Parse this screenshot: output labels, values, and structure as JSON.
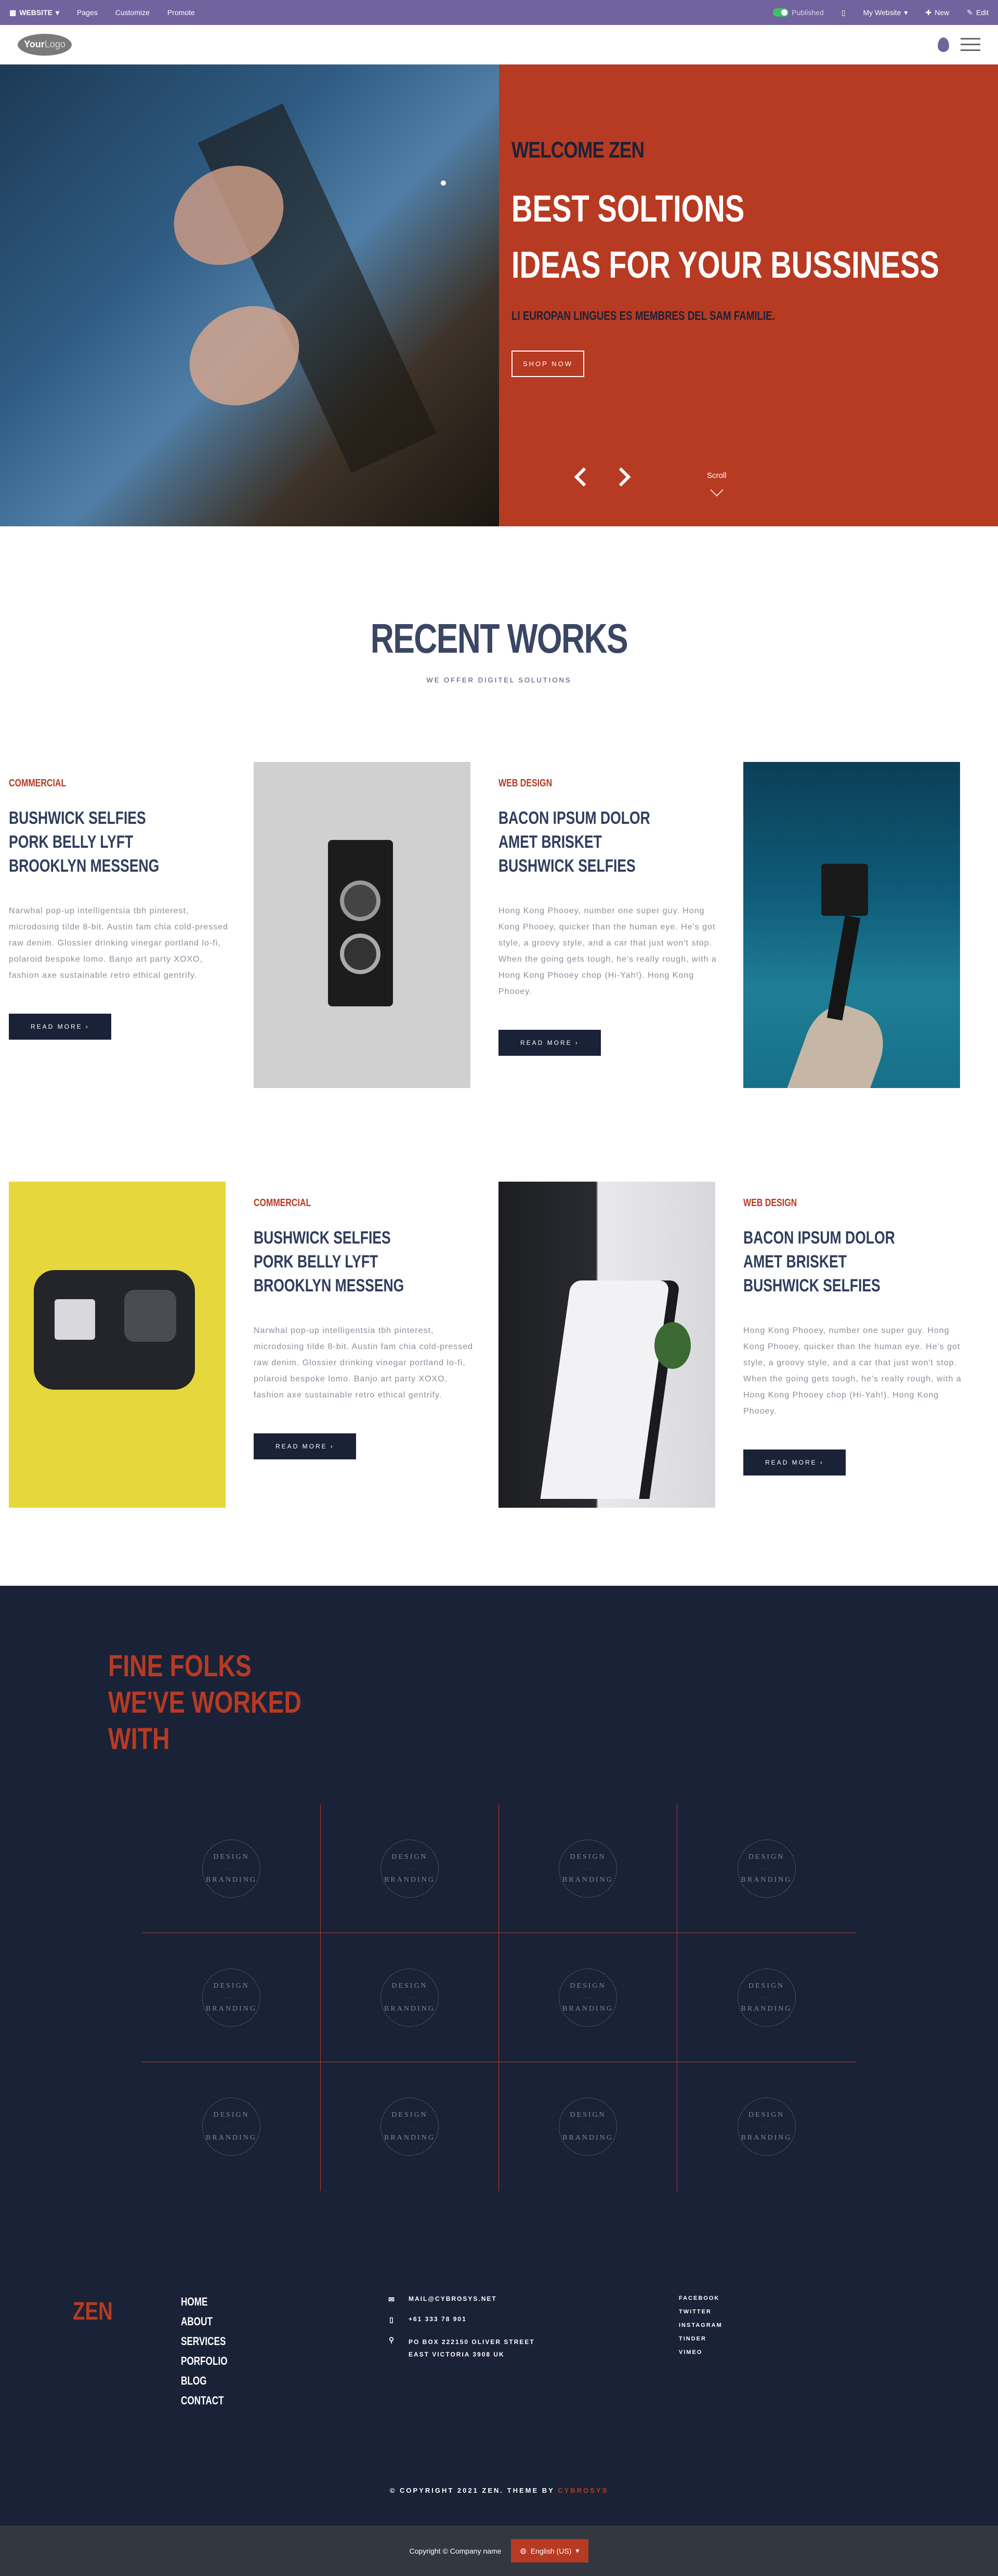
{
  "adminbar": {
    "website_label": "WEBSITE",
    "pages_label": "Pages",
    "customize_label": "Customize",
    "promote_label": "Promote",
    "published_label": "Published",
    "mywebsite_label": "My Website",
    "new_label": "New",
    "edit_label": "Edit"
  },
  "navbar": {
    "logo_your": "Your",
    "logo_logo": "Logo"
  },
  "hero": {
    "welcome": "WELCOME ZEN",
    "title_line1": "BEST SOLTIONS",
    "title_line2": "IDEAS FOR YOUR BUSSINESS",
    "subtitle": "LI EUROPAN LINGUES ES MEMBRES DEL SAM FAMILIE.",
    "button": "SHOP NOW",
    "scroll_label": "Scroll"
  },
  "works": {
    "title": "RECENT WORKS",
    "subtitle": "WE OFFER DIGITEL SOLUTIONS",
    "cards": [
      {
        "category": "COMMERCIAL",
        "title_lines": [
          "BUSHWICK SELFIES",
          "PORK BELLY LYFT",
          "BROOKLYN MESSENG"
        ],
        "description": "Narwhal pop-up intelligentsia tbh pinterest, microdosing tilde 8-bit. Austin fam chia cold-pressed raw denim. Glossier drinking vinegar portland lo-fi, polaroid bespoke lomo. Banjo art party XOXO, fashion axe sustainable retro ethical gentrify.",
        "button": "READ MORE"
      },
      {
        "category": "WEB DESIGN",
        "title_lines": [
          "BACON IPSUM DOLOR",
          "AMET BRISKET",
          "BUSHWICK SELFIES"
        ],
        "description": "Hong Kong Phooey, number one super guy. Hong Kong Phooey, quicker than the human eye. He's got style, a groovy style, and a car that just won't stop. When the going gets tough, he's really rough, with a Hong Kong Phooey chop (Hi-Yah!). Hong Kong Phooey.",
        "button": "READ MORE"
      },
      {
        "category": "COMMERCIAL",
        "title_lines": [
          "BUSHWICK SELFIES",
          "PORK BELLY LYFT",
          "BROOKLYN MESSENG"
        ],
        "description": "Narwhal pop-up intelligentsia tbh pinterest, microdosing tilde 8-bit. Austin fam chia cold-pressed raw denim. Glossier drinking vinegar portland lo-fi, polaroid bespoke lomo. Banjo art party XOXO, fashion axe sustainable retro ethical gentrify.",
        "button": "READ MORE"
      },
      {
        "category": "WEB DESIGN",
        "title_lines": [
          "BACON IPSUM DOLOR",
          "AMET BRISKET",
          "BUSHWICK SELFIES"
        ],
        "description": "Hong Kong Phooey, number one super guy. Hong Kong Phooey, quicker than the human eye. He's got style, a groovy style, and a car that just won't stop. When the going gets tough, he's really rough, with a Hong Kong Phooey chop (Hi-Yah!). Hong Kong Phooey.",
        "button": "READ MORE"
      }
    ]
  },
  "folks": {
    "title_lines": [
      "FINE FOLKS",
      "WE'VE WORKED",
      "WITH"
    ],
    "badge_top": "DESIGN",
    "badge_mid": "· · ·",
    "badge_bottom": "BRANDING"
  },
  "footer": {
    "brand": "ZEN",
    "nav": [
      "HOME",
      "ABOUT",
      "SERVICES",
      "PORFOLIO",
      "BLOG",
      "CONTACT"
    ],
    "email": "MAIL@CYBROSYS.NET",
    "phone": "+61 333 78 901",
    "address_line1": "PO BOX 222150 OLIVER STREET",
    "address_line2": "EAST VICTORIA 3908 UK",
    "social": [
      "FACEBOOK",
      "TWITTER",
      "INSTAGRAM",
      "TINDER",
      "VIMEO"
    ],
    "copyright_prefix": "© COPYRIGHT 2021 ZEN. THEME BY",
    "copyright_theme": "CYBROSYS"
  },
  "bottom_bar": {
    "company": "Copyright © Company name",
    "language": "English (US)"
  },
  "colors": {
    "accent": "#b73a22",
    "navy": "#1a2238",
    "admin": "#71639e"
  }
}
